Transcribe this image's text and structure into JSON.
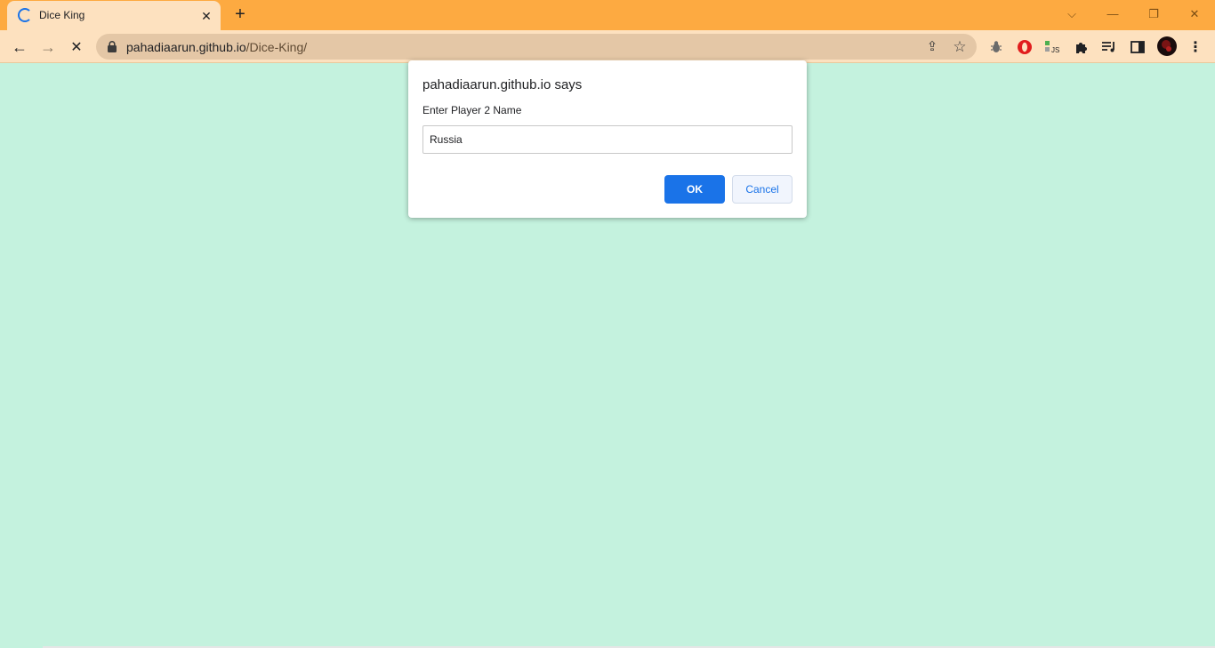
{
  "browser": {
    "tab": {
      "title": "Dice King",
      "close_glyph": "✕"
    },
    "new_tab_glyph": "+",
    "window_controls": {
      "tab_search": "⌵",
      "minimize": "—",
      "restore": "❐",
      "close": "✕"
    },
    "toolbar": {
      "back_glyph": "←",
      "forward_glyph": "→",
      "stop_glyph": "✕",
      "url_host": "pahadiaarun.github.io",
      "url_path": "/Dice-King/",
      "share_glyph": "⇪",
      "bookmark_glyph": "☆",
      "menu_glyph": "⋮"
    },
    "extensions": [
      "bug-icon",
      "opera-icon",
      "js-icon",
      "puzzle-icon",
      "media-icon",
      "sidepanel-icon"
    ],
    "ext_js_label": "JS"
  },
  "dialog": {
    "title": "pahadiaarun.github.io says",
    "message": "Enter Player 2 Name",
    "input_value": "Russia",
    "ok_label": "OK",
    "cancel_label": "Cancel"
  },
  "colors": {
    "page_bg": "#c4f2de",
    "tabstrip_bg": "#fdaa41",
    "toolbar_bg": "#fde1bf",
    "accent": "#1a73e8"
  }
}
